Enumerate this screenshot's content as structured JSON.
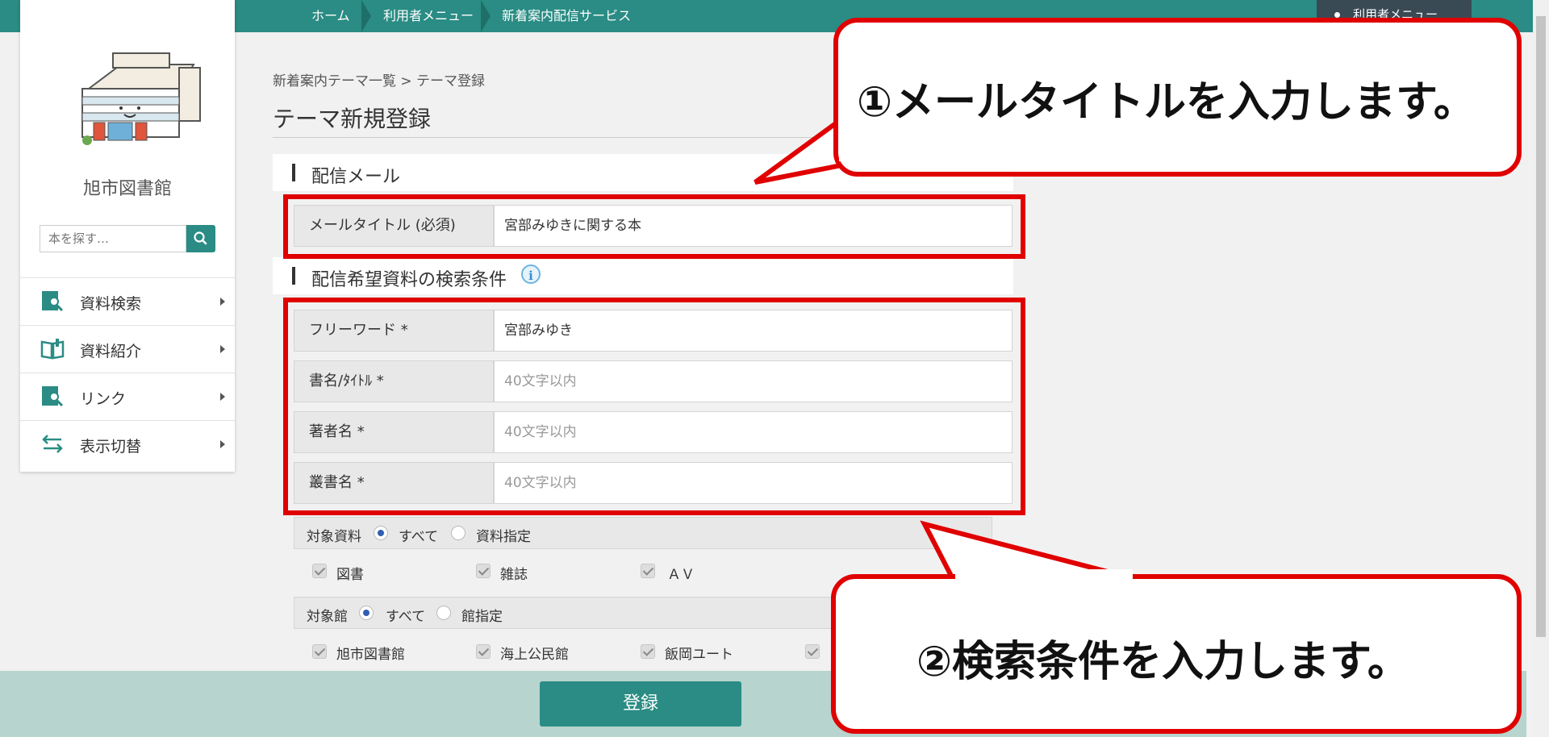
{
  "topbar": {
    "crumbs": [
      "ホーム",
      "利用者メニュー",
      "新着案内配信サービス"
    ],
    "user_menu": "利用者メニュー"
  },
  "sidebar": {
    "library_name": "旭市図書館",
    "search_placeholder": "本を探す…",
    "items": [
      {
        "label": "資料検索",
        "icon": "book-search-icon"
      },
      {
        "label": "資料紹介",
        "icon": "open-book-icon"
      },
      {
        "label": "リンク",
        "icon": "link-search-icon"
      },
      {
        "label": "表示切替",
        "icon": "swap-arrows-icon"
      }
    ]
  },
  "main": {
    "breadcrumb": "新着案内テーマ一覧 > テーマ登録",
    "page_title": "テーマ新規登録",
    "section_mail": "配信メール",
    "mail_title_label": "メールタイトル (必須)",
    "mail_title_value": "宮部みゆきに関する本",
    "section_search": "配信希望資料の検索条件",
    "info_glyph": "i",
    "fields": [
      {
        "label": "フリーワード *",
        "value": "宮部みゆき",
        "placeholder": ""
      },
      {
        "label": "書名/ﾀｲﾄﾙ *",
        "value": "",
        "placeholder": "40文字以内"
      },
      {
        "label": "著者名 *",
        "value": "",
        "placeholder": "40文字以内"
      },
      {
        "label": "叢書名 *",
        "value": "",
        "placeholder": "40文字以内"
      }
    ],
    "target_material": {
      "label": "対象資料",
      "option_all": "すべて",
      "option_specify": "資料指定",
      "selected": "all",
      "checks": [
        "図書",
        "雑誌",
        "ＡＶ"
      ]
    },
    "target_library": {
      "label": "対象館",
      "option_all": "すべて",
      "option_specify": "館指定",
      "selected": "all",
      "checks": [
        "旭市図書館",
        "海上公民館",
        "飯岡ユート"
      ]
    },
    "submit_label": "登録"
  },
  "callouts": {
    "one": "①メールタイトルを入力します。",
    "two": "②検索条件を入力します。"
  },
  "colors": {
    "teal": "#2a8c84",
    "highlight_red": "#e00000",
    "footer": "#b7d4cf"
  }
}
